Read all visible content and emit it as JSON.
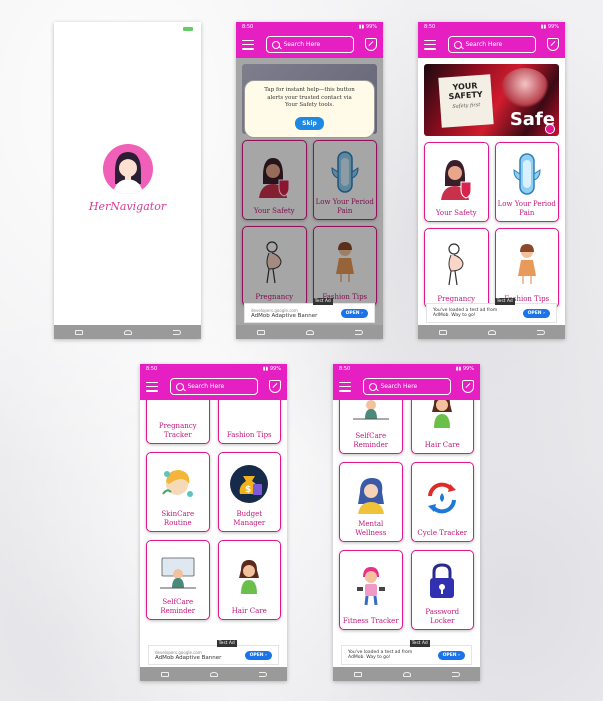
{
  "brand": {
    "magenta": "#e61fc2",
    "card_border": "#e0188c",
    "label_color": "#c2187a",
    "logo_text": "HerNavigator"
  },
  "common": {
    "status_time": "8:50",
    "search_placeholder": "Search Here",
    "ad": {
      "test_label": "Test Ad",
      "title_a": "AdMob Adaptive Banner",
      "title_b": "You've loaded a test ad from AdMob. Way to go!",
      "source": "developers.google.com",
      "open_label": "OPEN"
    }
  },
  "screen2": {
    "tooltip": "Tap for instant help—this button alerts your trusted contact via Your Safety tools.",
    "skip_label": "Skip",
    "cards": [
      "Your Safety",
      "Low Your Period Pain",
      "Pregnancy",
      "Fashion Tips"
    ]
  },
  "screen3": {
    "banner_title": "YOUR SAFETY",
    "banner_sub": "Safety first",
    "cards": [
      "Your Safety",
      "Low Your Period Pain",
      "Pregnancy",
      "Fashion Tips"
    ]
  },
  "screen4": {
    "cards": [
      "Pregnancy Tracker",
      "Fashion Tips",
      "SkinCare Routine",
      "Budget Manager",
      "SelfCare Reminder",
      "Hair Care"
    ]
  },
  "screen5": {
    "cards": [
      "SelfCare Reminder",
      "Hair Care",
      "Mental Wellness",
      "Cycle Tracker",
      "Fitness Tracker",
      "Password Locker"
    ]
  }
}
